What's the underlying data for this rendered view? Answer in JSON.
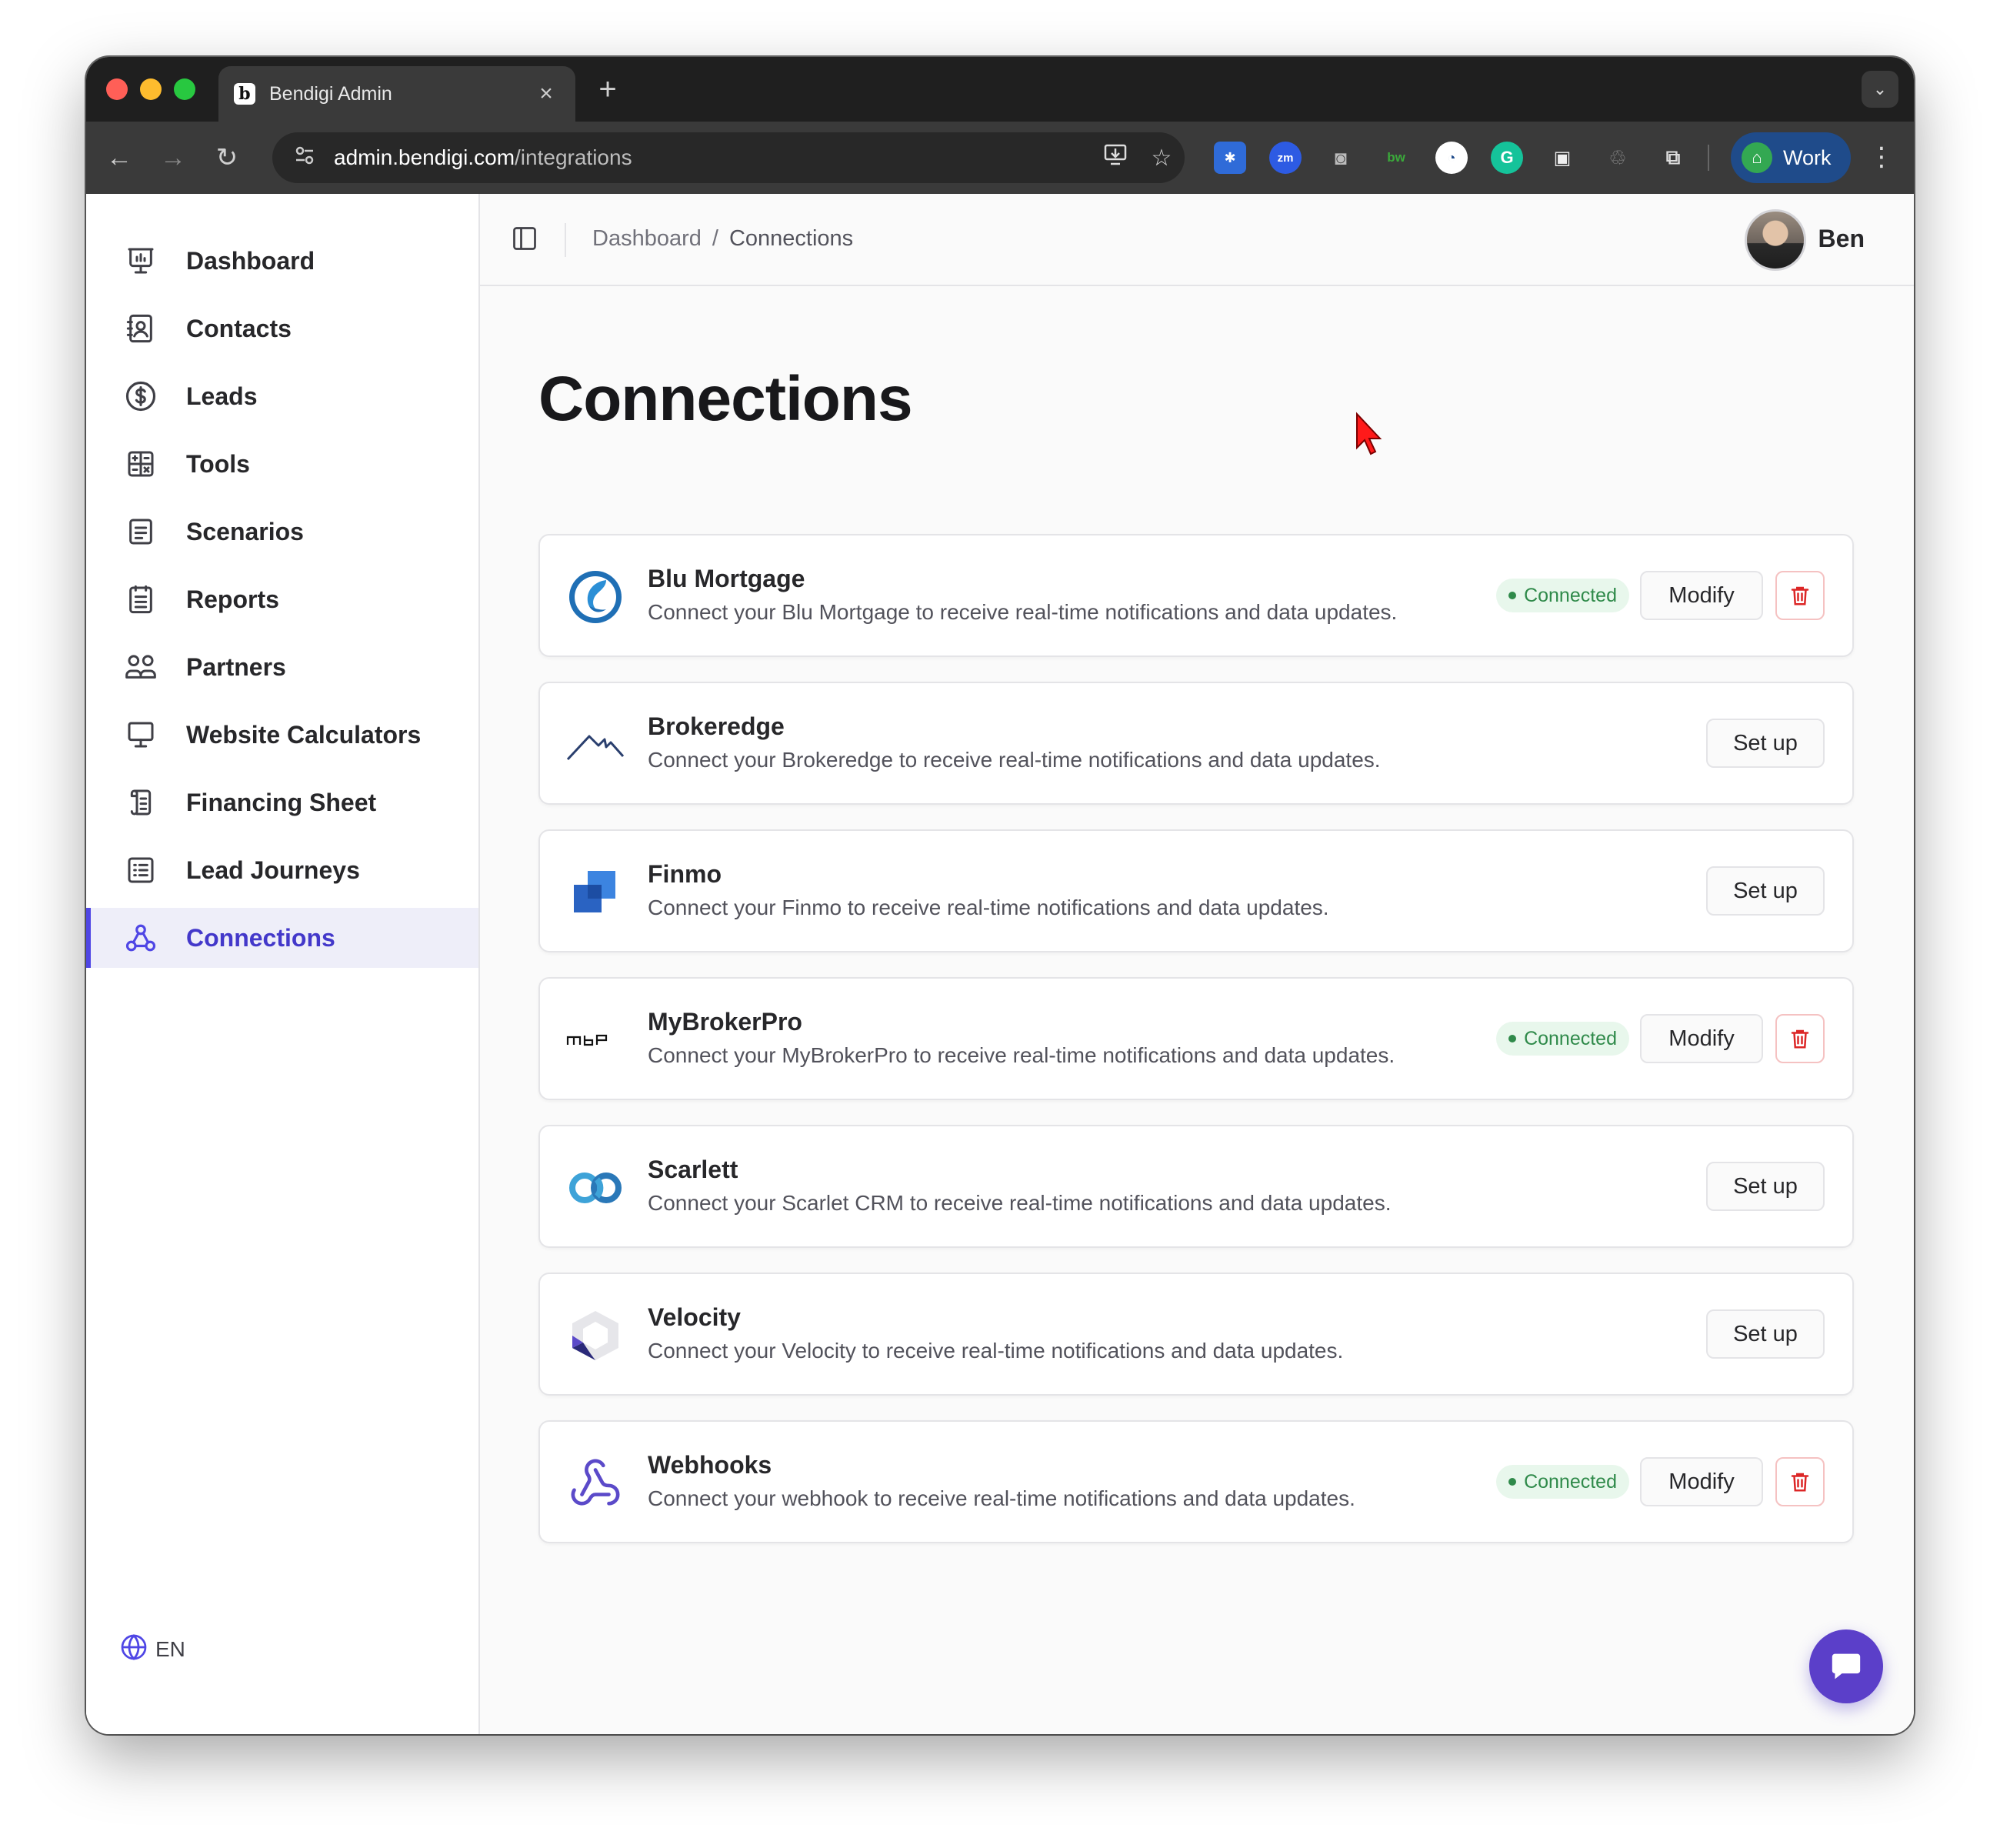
{
  "browser": {
    "tab_title": "Bendigi Admin",
    "tab_favicon": "b",
    "url_host": "admin.bendigi.com",
    "url_path": "/integrations",
    "profile_label": "Work",
    "extensions": [
      "asterisk-ext-icon",
      "zm-ext-icon",
      "camera-ext-icon",
      "bw-ext-icon",
      "lock-ext-icon",
      "grammarly-ext-icon",
      "wallet-ext-icon",
      "recycle-ext-icon",
      "puzzle-ext-icon"
    ],
    "ext_labels": {
      "zm": "zm",
      "bw": "bw"
    }
  },
  "sidebar": {
    "items": [
      {
        "label": "Dashboard",
        "icon": "presentation-chart-icon"
      },
      {
        "label": "Contacts",
        "icon": "contact-book-icon"
      },
      {
        "label": "Leads",
        "icon": "dollar-circle-icon"
      },
      {
        "label": "Tools",
        "icon": "calculator-icon"
      },
      {
        "label": "Scenarios",
        "icon": "document-list-icon"
      },
      {
        "label": "Reports",
        "icon": "report-icon"
      },
      {
        "label": "Partners",
        "icon": "users-icon"
      },
      {
        "label": "Website Calculators",
        "icon": "monitor-icon"
      },
      {
        "label": "Financing Sheet",
        "icon": "sheet-icon"
      },
      {
        "label": "Lead Journeys",
        "icon": "list-icon"
      },
      {
        "label": "Connections",
        "icon": "connections-icon",
        "active": true
      }
    ],
    "language": "EN"
  },
  "header": {
    "breadcrumb": [
      "Dashboard",
      "/",
      "Connections"
    ],
    "user_name": "Ben"
  },
  "page": {
    "title": "Connections"
  },
  "connections": [
    {
      "name": "Blu Mortgage",
      "description": "Connect your Blu Mortgage to receive real-time notifications and data updates.",
      "status": "Connected",
      "logo": "blu-mortgage-logo"
    },
    {
      "name": "Brokeredge",
      "description": "Connect your Brokeredge to receive real-time notifications and data updates.",
      "status": "",
      "logo": "brokeredge-logo"
    },
    {
      "name": "Finmo",
      "description": "Connect your Finmo to receive real-time notifications and data updates.",
      "status": "",
      "logo": "finmo-logo"
    },
    {
      "name": "MyBrokerPro",
      "description": "Connect your MyBrokerPro to receive real-time notifications and data updates.",
      "status": "Connected",
      "logo": "mybrokerpro-logo",
      "logo_text": "ᴍʙᴘ"
    },
    {
      "name": "Scarlett",
      "description": "Connect your Scarlet CRM to receive real-time notifications and data updates.",
      "status": "",
      "logo": "scarlett-logo"
    },
    {
      "name": "Velocity",
      "description": "Connect your Velocity to receive real-time notifications and data updates.",
      "status": "",
      "logo": "velocity-logo"
    },
    {
      "name": "Webhooks",
      "description": "Connect your webhook to receive real-time notifications and data updates.",
      "status": "Connected",
      "logo": "webhooks-logo"
    }
  ],
  "buttons": {
    "setup": "Set up",
    "modify": "Modify"
  },
  "colors": {
    "accent": "#4f46e5",
    "connected_bg": "#e8f7ec",
    "connected_text": "#2f8a4a",
    "delete": "#dc2626",
    "chat_fab": "#5b3fc9"
  }
}
